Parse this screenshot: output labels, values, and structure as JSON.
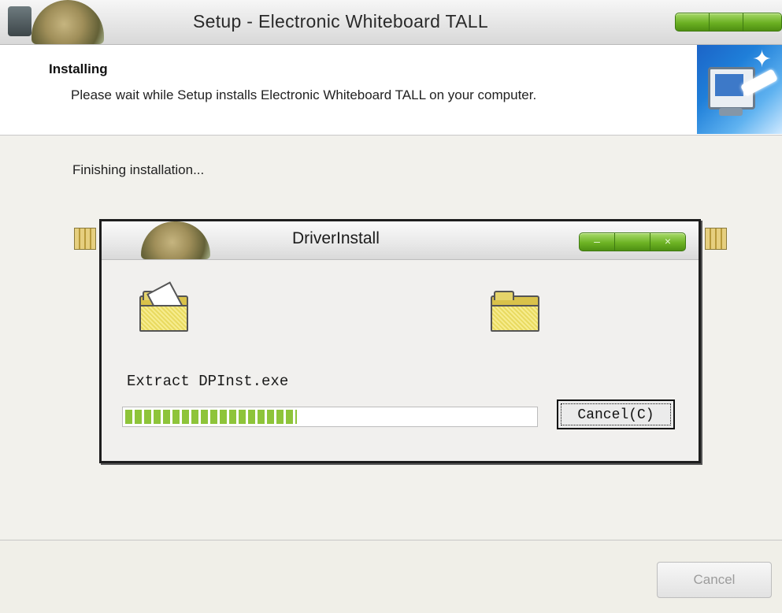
{
  "setup_window": {
    "title": "Setup - Electronic Whiteboard TALL",
    "header": {
      "title": "Installing",
      "subtitle": "Please wait while Setup installs Electronic Whiteboard TALL on your computer."
    },
    "status_text": "Finishing installation...",
    "cancel_label": "Cancel"
  },
  "driver_dialog": {
    "title": "DriverInstall",
    "extract_text": "Extract DPInst.exe",
    "progress_percent": 42,
    "cancel_label": "Cancel(C)",
    "controls": {
      "minimize": "–",
      "close": "×"
    }
  },
  "colors": {
    "accent_green": "#6bb022",
    "progress_green": "#8ec43a",
    "folder_yellow": "#e9da60"
  },
  "icons": [
    "app-icon",
    "wizard-computer-icon",
    "folder-open-icon",
    "folder-closed-icon",
    "minimize-icon",
    "close-icon"
  ]
}
